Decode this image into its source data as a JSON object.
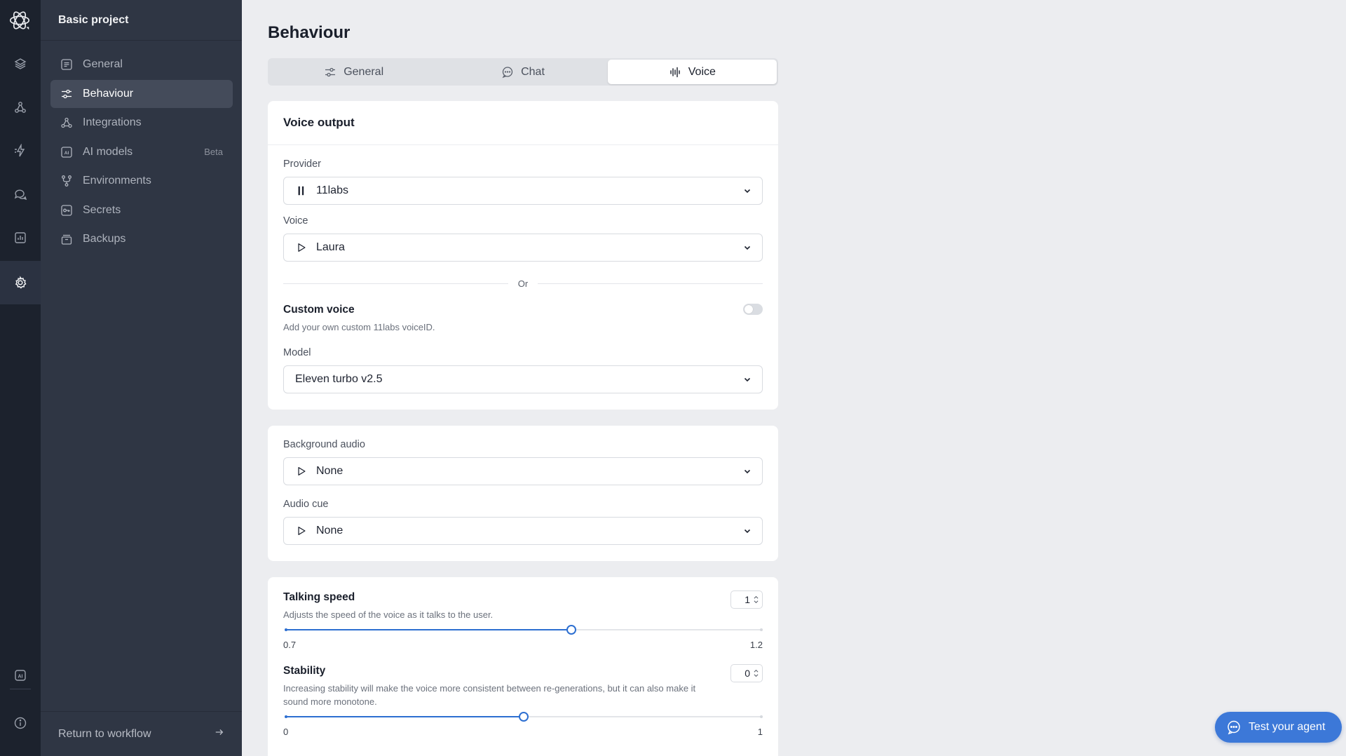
{
  "app": {
    "project_name": "Basic project"
  },
  "rail": {
    "items": [
      {
        "name": "layers-icon"
      },
      {
        "name": "integrations-icon"
      },
      {
        "name": "lightning-icon"
      },
      {
        "name": "chat-icon"
      },
      {
        "name": "analytics-icon"
      },
      {
        "name": "settings-icon",
        "active": true
      }
    ],
    "bottom": [
      {
        "name": "ai-icon"
      },
      {
        "name": "info-icon"
      }
    ]
  },
  "sidebar": {
    "items": [
      {
        "label": "General",
        "icon": "general-icon"
      },
      {
        "label": "Behaviour",
        "icon": "sliders-icon",
        "active": true
      },
      {
        "label": "Integrations",
        "icon": "integrations-icon"
      },
      {
        "label": "AI models",
        "icon": "ai-icon",
        "badge": "Beta"
      },
      {
        "label": "Environments",
        "icon": "branch-icon"
      },
      {
        "label": "Secrets",
        "icon": "key-icon"
      },
      {
        "label": "Backups",
        "icon": "archive-icon"
      }
    ],
    "footer_label": "Return to workflow"
  },
  "page": {
    "title": "Behaviour",
    "tabs": [
      {
        "label": "General",
        "icon": "sliders-icon"
      },
      {
        "label": "Chat",
        "icon": "chat-icon"
      },
      {
        "label": "Voice",
        "icon": "waveform-icon",
        "active": true
      }
    ]
  },
  "voice_output": {
    "title": "Voice output",
    "provider_label": "Provider",
    "provider_value": "11labs",
    "voice_label": "Voice",
    "voice_value": "Laura",
    "or_text": "Or",
    "custom_voice_title": "Custom voice",
    "custom_voice_desc": "Add your own custom 11labs voiceID.",
    "custom_voice_enabled": false,
    "model_label": "Model",
    "model_value": "Eleven turbo v2.5"
  },
  "audio": {
    "background_label": "Background audio",
    "background_value": "None",
    "cue_label": "Audio cue",
    "cue_value": "None"
  },
  "sliders": {
    "talking_speed": {
      "title": "Talking speed",
      "desc": "Adjusts the speed of the voice as it talks to the user.",
      "value": "1",
      "min": "0.7",
      "max": "1.2",
      "fraction": 0.6
    },
    "stability": {
      "title": "Stability",
      "desc": "Increasing stability will make the voice more consistent between re-generations, but it can also make it sound more monotone.",
      "value": "0",
      "min": "0",
      "max": "1",
      "fraction": 0.5
    }
  },
  "fab": {
    "label": "Test your agent"
  },
  "colors": {
    "accent": "#3c78d8",
    "slider": "#2d6fd1",
    "rail_bg": "#1c222d",
    "sidebar_bg": "#2f3644"
  }
}
